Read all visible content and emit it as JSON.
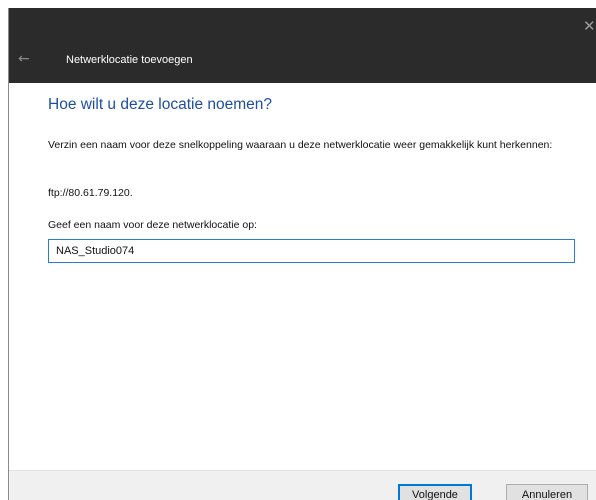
{
  "window": {
    "title": "Netwerklocatie toevoegen",
    "close_glyph": "✕",
    "back_glyph": "←"
  },
  "main": {
    "heading": "Hoe wilt u deze locatie noemen?",
    "description": "Verzin een naam voor deze snelkoppeling waaraan u deze netwerklocatie weer gemakkelijk kunt herkennen:",
    "location_url": "ftp://80.61.79.120.",
    "name_label": "Geef een naam voor deze netwerklocatie op:",
    "name_value": "NAS_Studio074"
  },
  "footer": {
    "next_label": "Volgende",
    "cancel_label": "Annuleren"
  },
  "icons": {
    "back": "back-arrow-icon",
    "close": "close-icon"
  },
  "colors": {
    "titlebar": "#2b2b2b",
    "heading": "#1e4fa0",
    "focus_border": "#2c7bd6",
    "footer": "#f0f0f0"
  }
}
